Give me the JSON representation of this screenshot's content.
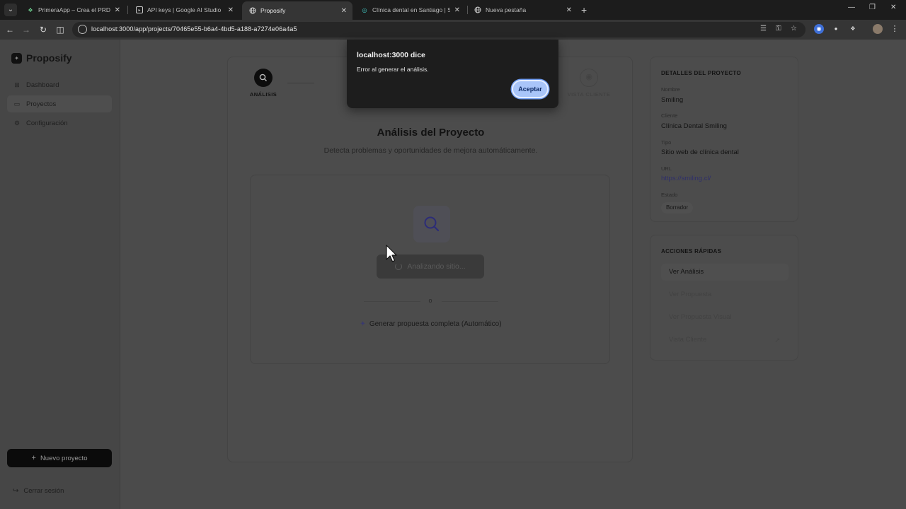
{
  "browser": {
    "tabs": [
      {
        "label": "PrimeraApp – Crea el PRD y Pro",
        "icon": "app-favicon",
        "active": false
      },
      {
        "label": "API keys | Google AI Studio",
        "icon": "ai-studio-favicon",
        "active": false
      },
      {
        "label": "Proposify",
        "icon": "globe-icon",
        "active": true
      },
      {
        "label": "Clínica dental en Santiago | Smi",
        "icon": "dental-favicon",
        "active": false
      },
      {
        "label": "Nueva pestaña",
        "icon": "globe-icon",
        "active": false
      }
    ],
    "url": "localhost:3000/app/projects/70465e55-b6a4-4bd5-a188-a7274e06a4a5"
  },
  "sidebar": {
    "brand": "Proposify",
    "items": [
      {
        "label": "Dashboard",
        "icon": "grid-icon"
      },
      {
        "label": "Proyectos",
        "icon": "folder-icon",
        "active": true
      },
      {
        "label": "Configuración",
        "icon": "gear-icon"
      }
    ],
    "new_project": "Nuevo proyecto",
    "logout": "Cerrar sesión"
  },
  "stepper": {
    "first_step": "ANÁLISIS",
    "last_step": "VISTA CLIENTE"
  },
  "analysis": {
    "title": "Análisis del Proyecto",
    "subtitle": "Detecta problemas y oportunidades de mejora automáticamente.",
    "button": "Analizando sitio...",
    "or": "o",
    "auto_link": "Generar propuesta completa (Automático)"
  },
  "details": {
    "title": "DETALLES DEL PROYECTO",
    "name_label": "Nombre",
    "name": "Smiling",
    "client_label": "Cliente",
    "client": "Clínica Dental Smiling",
    "type_label": "Tipo",
    "type": "Sitio web de clínica dental",
    "url_label": "URL",
    "url": "https://smiling.cl/",
    "status_label": "Estado",
    "status": "Borrador"
  },
  "quick_actions": {
    "title": "ACCIONES RÁPIDAS",
    "items": [
      "Ver Análisis",
      "Ver Propuesta",
      "Ver Propuesta Visual",
      "Vista Cliente"
    ]
  },
  "dialog": {
    "title": "localhost:3000 dice",
    "message": "Error al generar el análisis.",
    "button": "Aceptar"
  }
}
